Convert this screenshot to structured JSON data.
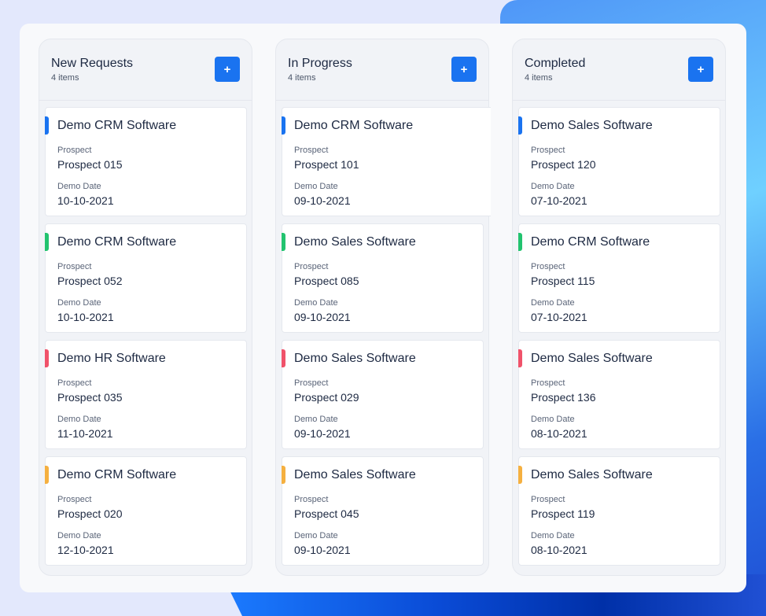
{
  "colors": {
    "accent": "#1a73f0",
    "bar_blue": "#1a73f0",
    "bar_green": "#22c36f",
    "bar_red": "#f0526a",
    "bar_orange": "#f5b040"
  },
  "labels": {
    "prospect": "Prospect",
    "demo_date": "Demo Date",
    "add": "+"
  },
  "columns": [
    {
      "title": "New Requests",
      "count": "4 items",
      "cards": [
        {
          "title": "Demo CRM Software",
          "prospect": "Prospect 015",
          "date": "10-10-2021",
          "color": "#1a73f0"
        },
        {
          "title": "Demo CRM Software",
          "prospect": "Prospect 052",
          "date": "10-10-2021",
          "color": "#22c36f"
        },
        {
          "title": "Demo HR Software",
          "prospect": "Prospect 035",
          "date": "11-10-2021",
          "color": "#f0526a"
        },
        {
          "title": "Demo CRM Software",
          "prospect": "Prospect 020",
          "date": "12-10-2021",
          "color": "#f5b040"
        }
      ]
    },
    {
      "title": "In Progress",
      "count": "4 items",
      "cards": [
        {
          "title": "Demo CRM Software",
          "prospect": "Prospect 101",
          "date": "09-10-2021",
          "color": "#1a73f0"
        },
        {
          "title": "Demo Sales Software",
          "prospect": "Prospect 085",
          "date": "09-10-2021",
          "color": "#22c36f"
        },
        {
          "title": "Demo Sales Software",
          "prospect": "Prospect 029",
          "date": "09-10-2021",
          "color": "#f0526a"
        },
        {
          "title": "Demo Sales Software",
          "prospect": "Prospect 045",
          "date": "09-10-2021",
          "color": "#f5b040"
        }
      ]
    },
    {
      "title": "Completed",
      "count": "4 items",
      "cards": [
        {
          "title": "Demo Sales Software",
          "prospect": "Prospect 120",
          "date": "07-10-2021",
          "color": "#1a73f0"
        },
        {
          "title": "Demo CRM Software",
          "prospect": "Prospect 115",
          "date": "07-10-2021",
          "color": "#22c36f"
        },
        {
          "title": "Demo Sales Software",
          "prospect": "Prospect 136",
          "date": "08-10-2021",
          "color": "#f0526a"
        },
        {
          "title": "Demo Sales Software",
          "prospect": "Prospect 119",
          "date": "08-10-2021",
          "color": "#f5b040"
        }
      ]
    }
  ]
}
